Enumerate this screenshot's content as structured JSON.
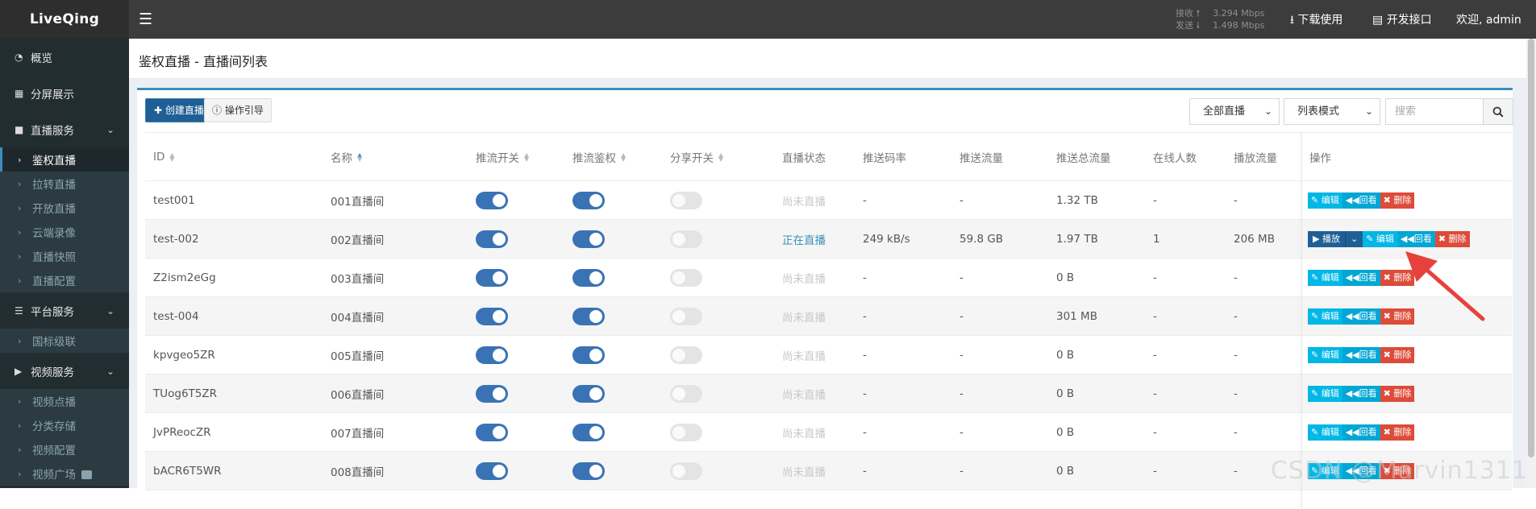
{
  "topbar": {
    "logo": "LiveQing",
    "menu_icon": "bars-icon",
    "stats": {
      "recv_label": "接收",
      "recv_value": "3.294 Mbps",
      "send_label": "发送",
      "send_value": "1.498 Mbps"
    },
    "download_label": "下载使用",
    "api_label": "开发接口",
    "welcome": "欢迎, admin"
  },
  "sidebar": {
    "overview": "概览",
    "split_screen": "分屏展示",
    "live_service": "直播服务",
    "live_items": [
      "鉴权直播",
      "拉转直播",
      "开放直播",
      "云端录像",
      "直播快照",
      "直播配置"
    ],
    "platform_service": "平台服务",
    "platform_items": [
      "国标级联"
    ],
    "video_service": "视频服务",
    "video_items": [
      "视频点播",
      "分类存储",
      "视频配置",
      "视频广场"
    ]
  },
  "page": {
    "title": "鉴权直播 - 直播间列表"
  },
  "toolbar": {
    "create_label": "创建直播",
    "guide_label": "操作引导",
    "filter_value": "全部直播",
    "mode_value": "列表模式",
    "search_placeholder": "搜索"
  },
  "table": {
    "headers": {
      "id": "ID",
      "name": "名称",
      "push_switch": "推流开关",
      "push_auth": "推流鉴权",
      "share_switch": "分享开关",
      "live_status": "直播状态",
      "bitrate": "推送码率",
      "push_flow": "推送流量",
      "push_total": "推送总流量",
      "online": "在线人数",
      "play_flow": "播放流量",
      "ops": "操作"
    },
    "rows": [
      {
        "id": "test001",
        "name": "001直播间",
        "push_on": true,
        "auth_on": true,
        "share_on": false,
        "status": "尚未直播",
        "bitrate": "-",
        "push_flow": "-",
        "push_total": "1.32 TB",
        "online": "-",
        "play_flow": "-",
        "live": false
      },
      {
        "id": "test-002",
        "name": "002直播间",
        "push_on": true,
        "auth_on": true,
        "share_on": false,
        "status": "正在直播",
        "bitrate": "249 kB/s",
        "push_flow": "59.8 GB",
        "push_total": "1.97 TB",
        "online": "1",
        "play_flow": "206 MB",
        "live": true
      },
      {
        "id": "Z2ism2eGg",
        "name": "003直播间",
        "push_on": true,
        "auth_on": true,
        "share_on": false,
        "status": "尚未直播",
        "bitrate": "-",
        "push_flow": "-",
        "push_total": "0 B",
        "online": "-",
        "play_flow": "-",
        "live": false
      },
      {
        "id": "test-004",
        "name": "004直播间",
        "push_on": true,
        "auth_on": true,
        "share_on": false,
        "status": "尚未直播",
        "bitrate": "-",
        "push_flow": "-",
        "push_total": "301 MB",
        "online": "-",
        "play_flow": "-",
        "live": false
      },
      {
        "id": "kpvgeo5ZR",
        "name": "005直播间",
        "push_on": true,
        "auth_on": true,
        "share_on": false,
        "status": "尚未直播",
        "bitrate": "-",
        "push_flow": "-",
        "push_total": "0 B",
        "online": "-",
        "play_flow": "-",
        "live": false
      },
      {
        "id": "TUog6T5ZR",
        "name": "006直播间",
        "push_on": true,
        "auth_on": true,
        "share_on": false,
        "status": "尚未直播",
        "bitrate": "-",
        "push_flow": "-",
        "push_total": "0 B",
        "online": "-",
        "play_flow": "-",
        "live": false
      },
      {
        "id": "JvPReocZR",
        "name": "007直播间",
        "push_on": true,
        "auth_on": true,
        "share_on": false,
        "status": "尚未直播",
        "bitrate": "-",
        "push_flow": "-",
        "push_total": "0 B",
        "online": "-",
        "play_flow": "-",
        "live": false
      },
      {
        "id": "bACR6T5WR",
        "name": "008直播间",
        "push_on": true,
        "auth_on": true,
        "share_on": false,
        "status": "尚未直播",
        "bitrate": "-",
        "push_flow": "-",
        "push_total": "0 B",
        "online": "-",
        "play_flow": "-",
        "live": false
      }
    ],
    "ops": {
      "play": "播放",
      "edit": "编辑",
      "replay": "回看",
      "delete": "删除"
    }
  },
  "annotation": {
    "arrow_color": "#e8413c"
  },
  "watermark": "CSDN @Marvin1311"
}
